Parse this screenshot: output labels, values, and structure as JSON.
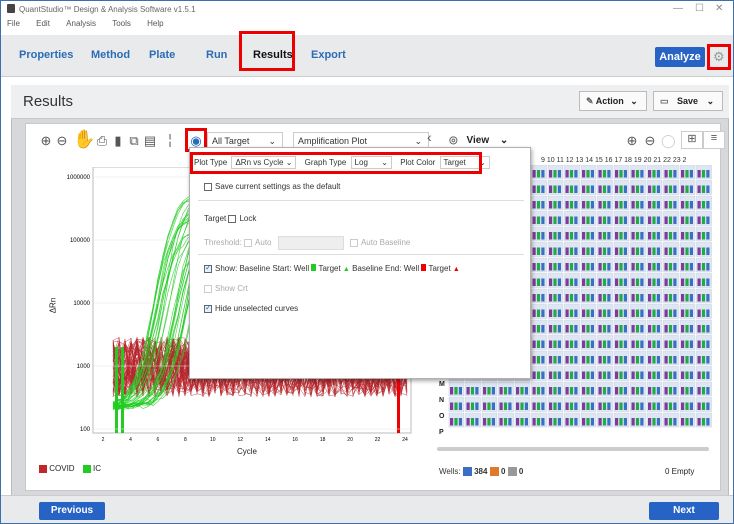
{
  "window": {
    "title": "QuantStudio™ Design & Analysis Software v1.5.1",
    "controls": [
      "—",
      "☐",
      "✕"
    ]
  },
  "menu": [
    "File",
    "Edit",
    "Analysis",
    "Tools",
    "Help"
  ],
  "tabs": [
    "Properties",
    "Method",
    "Plate",
    "Run",
    "Results",
    "Export"
  ],
  "active_tab": "Results",
  "analyze_label": "Analyze",
  "page_title": "Results",
  "action_label": "Action",
  "save_label": "Save",
  "plot": {
    "target_select": "All Target",
    "plot_select": "Amplification Plot",
    "view_label": "View",
    "y_axis_label": "ΔRn",
    "x_axis_label": "Cycle",
    "y_ticks": [
      "1000000",
      "100000",
      "10000",
      "1000",
      "100"
    ],
    "x_ticks": [
      "2",
      "4",
      "6",
      "8",
      "10",
      "12",
      "14",
      "16",
      "18",
      "20",
      "22",
      "24"
    ],
    "legend": [
      {
        "label": "COVID",
        "color": "#c0272d"
      },
      {
        "label": "IC",
        "color": "#22cc22"
      }
    ]
  },
  "settings_popup": {
    "plot_type_label": "Plot Type",
    "plot_type_value": "ΔRn vs Cycle",
    "graph_type_label": "Graph Type",
    "graph_type_value": "Log",
    "plot_color_label": "Plot Color",
    "plot_color_value": "Target",
    "save_default_label": "Save current settings as the default",
    "target_label": "Target",
    "lock_label": "Lock",
    "threshold_label": "Threshold:",
    "auto_label": "Auto",
    "auto_baseline_label": "Auto Baseline",
    "show_label": "Show: Baseline Start:",
    "well_label": "Well",
    "target_item_label": "Target",
    "baseline_end_label": "Baseline End:",
    "show_crt_label": "Show Crt",
    "hide_unselected_label": "Hide unselected curves"
  },
  "plate": {
    "columns_header": "9  10  11  12  13  14  15  16  17  18  19  20  21  22  23  2",
    "rows": [
      "M",
      "N",
      "O",
      "P"
    ],
    "wells_label": "Wells:",
    "wells_total": "384",
    "wells_b": "0",
    "wells_c": "0",
    "empty_label": "0 Empty"
  },
  "footer": {
    "previous_label": "Previous",
    "next_label": "Next"
  }
}
